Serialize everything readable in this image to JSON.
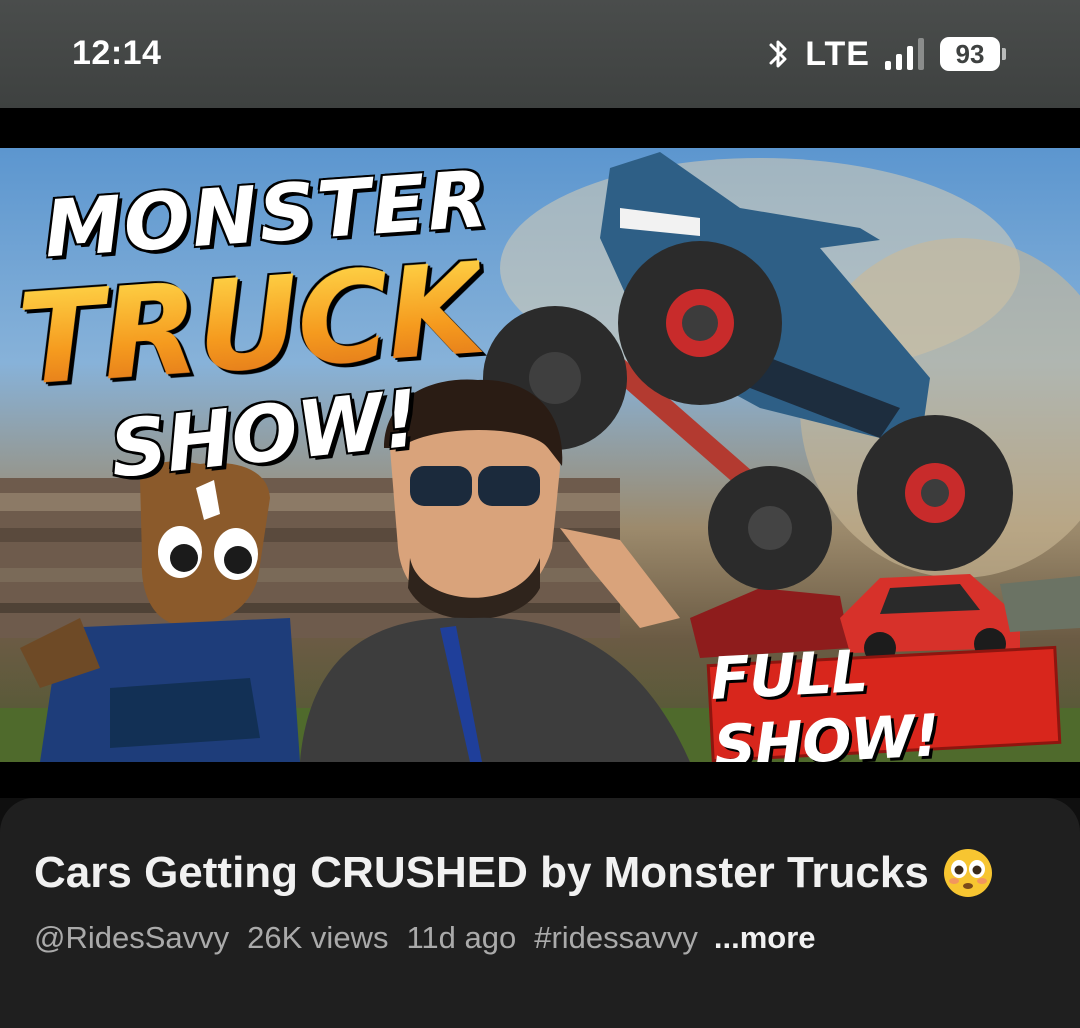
{
  "status_bar": {
    "time": "12:14",
    "network": "LTE",
    "battery": "93",
    "icons": [
      "bluetooth-icon",
      "signal-icon",
      "battery-icon"
    ]
  },
  "thumbnail": {
    "headline_line1": "MONSTER",
    "headline_line2": "TRUCK",
    "headline_line3": "SHOW!",
    "badge": "FULL SHOW!",
    "colors": {
      "badge": "#d8261c",
      "headline_accent": "#f5a623"
    }
  },
  "video": {
    "title": "Cars Getting CRUSHED by Monster Trucks",
    "title_emoji": "flushed-face-emoji",
    "channel": "@RidesSavvy",
    "views": "26K views",
    "age": "11d ago",
    "hashtag": "#ridessavvy",
    "more_label": "...more"
  }
}
